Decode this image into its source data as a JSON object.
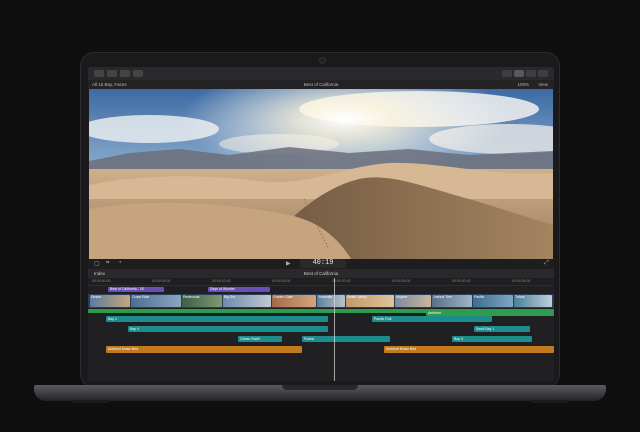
{
  "app": {
    "library_label": "All 15 Bay, Faces",
    "project_title": "Best of California",
    "zoom": "100%",
    "view_label": "View"
  },
  "viewer": {
    "timecode": "40:19"
  },
  "timeline": {
    "index_tab": "Index",
    "project_name": "Best of California",
    "ruler_ticks": [
      "00:00:00:00",
      "00:00:05:00",
      "00:00:10:00",
      "00:00:15:00",
      "00:00:20:00",
      "00:00:25:00",
      "00:00:30:00",
      "00:00:35:00"
    ],
    "title_clips": [
      "Best of California - 2K",
      "Days of Wonder"
    ],
    "primary_clips": [
      "Desert",
      "Coast Ride",
      "Redwoods",
      "Big Sur",
      "Golden Gate",
      "Yosemite",
      "Death Valley",
      "Mojave",
      "Joshua Tree",
      "Pacific",
      "Tahoe"
    ],
    "audio_labels": [
      "Bay 1",
      "Pacific Roll",
      "Ambient",
      "Bay 4",
      "Swell Bay 1",
      "Ocean Swell",
      "Forest",
      "Bay 3",
      "Ambient Music Bed",
      "Ambient Music Bed"
    ]
  },
  "colors": {
    "accent_teal": "#1c8c8c",
    "accent_green": "#2e9c4e",
    "accent_orange": "#c27a1f",
    "accent_purple": "#6a4fb6",
    "accent_blue": "#3d6fb0"
  },
  "icons": [
    "back-icon",
    "forward-icon",
    "import-icon",
    "share-icon",
    "layout-icon",
    "search-icon",
    "settings-icon",
    "play-icon",
    "fullscreen-icon"
  ]
}
